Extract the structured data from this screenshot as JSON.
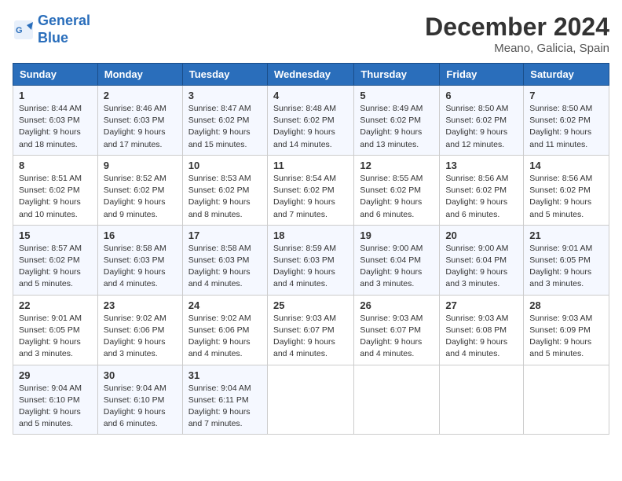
{
  "logo": {
    "line1": "General",
    "line2": "Blue"
  },
  "title": "December 2024",
  "location": "Meano, Galicia, Spain",
  "weekdays": [
    "Sunday",
    "Monday",
    "Tuesday",
    "Wednesday",
    "Thursday",
    "Friday",
    "Saturday"
  ],
  "weeks": [
    [
      {
        "day": "1",
        "sunrise": "8:44 AM",
        "sunset": "6:03 PM",
        "daylight": "9 hours and 18 minutes."
      },
      {
        "day": "2",
        "sunrise": "8:46 AM",
        "sunset": "6:03 PM",
        "daylight": "9 hours and 17 minutes."
      },
      {
        "day": "3",
        "sunrise": "8:47 AM",
        "sunset": "6:02 PM",
        "daylight": "9 hours and 15 minutes."
      },
      {
        "day": "4",
        "sunrise": "8:48 AM",
        "sunset": "6:02 PM",
        "daylight": "9 hours and 14 minutes."
      },
      {
        "day": "5",
        "sunrise": "8:49 AM",
        "sunset": "6:02 PM",
        "daylight": "9 hours and 13 minutes."
      },
      {
        "day": "6",
        "sunrise": "8:50 AM",
        "sunset": "6:02 PM",
        "daylight": "9 hours and 12 minutes."
      },
      {
        "day": "7",
        "sunrise": "8:50 AM",
        "sunset": "6:02 PM",
        "daylight": "9 hours and 11 minutes."
      }
    ],
    [
      {
        "day": "8",
        "sunrise": "8:51 AM",
        "sunset": "6:02 PM",
        "daylight": "9 hours and 10 minutes."
      },
      {
        "day": "9",
        "sunrise": "8:52 AM",
        "sunset": "6:02 PM",
        "daylight": "9 hours and 9 minutes."
      },
      {
        "day": "10",
        "sunrise": "8:53 AM",
        "sunset": "6:02 PM",
        "daylight": "9 hours and 8 minutes."
      },
      {
        "day": "11",
        "sunrise": "8:54 AM",
        "sunset": "6:02 PM",
        "daylight": "9 hours and 7 minutes."
      },
      {
        "day": "12",
        "sunrise": "8:55 AM",
        "sunset": "6:02 PM",
        "daylight": "9 hours and 6 minutes."
      },
      {
        "day": "13",
        "sunrise": "8:56 AM",
        "sunset": "6:02 PM",
        "daylight": "9 hours and 6 minutes."
      },
      {
        "day": "14",
        "sunrise": "8:56 AM",
        "sunset": "6:02 PM",
        "daylight": "9 hours and 5 minutes."
      }
    ],
    [
      {
        "day": "15",
        "sunrise": "8:57 AM",
        "sunset": "6:02 PM",
        "daylight": "9 hours and 5 minutes."
      },
      {
        "day": "16",
        "sunrise": "8:58 AM",
        "sunset": "6:03 PM",
        "daylight": "9 hours and 4 minutes."
      },
      {
        "day": "17",
        "sunrise": "8:58 AM",
        "sunset": "6:03 PM",
        "daylight": "9 hours and 4 minutes."
      },
      {
        "day": "18",
        "sunrise": "8:59 AM",
        "sunset": "6:03 PM",
        "daylight": "9 hours and 4 minutes."
      },
      {
        "day": "19",
        "sunrise": "9:00 AM",
        "sunset": "6:04 PM",
        "daylight": "9 hours and 3 minutes."
      },
      {
        "day": "20",
        "sunrise": "9:00 AM",
        "sunset": "6:04 PM",
        "daylight": "9 hours and 3 minutes."
      },
      {
        "day": "21",
        "sunrise": "9:01 AM",
        "sunset": "6:05 PM",
        "daylight": "9 hours and 3 minutes."
      }
    ],
    [
      {
        "day": "22",
        "sunrise": "9:01 AM",
        "sunset": "6:05 PM",
        "daylight": "9 hours and 3 minutes."
      },
      {
        "day": "23",
        "sunrise": "9:02 AM",
        "sunset": "6:06 PM",
        "daylight": "9 hours and 3 minutes."
      },
      {
        "day": "24",
        "sunrise": "9:02 AM",
        "sunset": "6:06 PM",
        "daylight": "9 hours and 4 minutes."
      },
      {
        "day": "25",
        "sunrise": "9:03 AM",
        "sunset": "6:07 PM",
        "daylight": "9 hours and 4 minutes."
      },
      {
        "day": "26",
        "sunrise": "9:03 AM",
        "sunset": "6:07 PM",
        "daylight": "9 hours and 4 minutes."
      },
      {
        "day": "27",
        "sunrise": "9:03 AM",
        "sunset": "6:08 PM",
        "daylight": "9 hours and 4 minutes."
      },
      {
        "day": "28",
        "sunrise": "9:03 AM",
        "sunset": "6:09 PM",
        "daylight": "9 hours and 5 minutes."
      }
    ],
    [
      {
        "day": "29",
        "sunrise": "9:04 AM",
        "sunset": "6:10 PM",
        "daylight": "9 hours and 5 minutes."
      },
      {
        "day": "30",
        "sunrise": "9:04 AM",
        "sunset": "6:10 PM",
        "daylight": "9 hours and 6 minutes."
      },
      {
        "day": "31",
        "sunrise": "9:04 AM",
        "sunset": "6:11 PM",
        "daylight": "9 hours and 7 minutes."
      },
      null,
      null,
      null,
      null
    ]
  ]
}
